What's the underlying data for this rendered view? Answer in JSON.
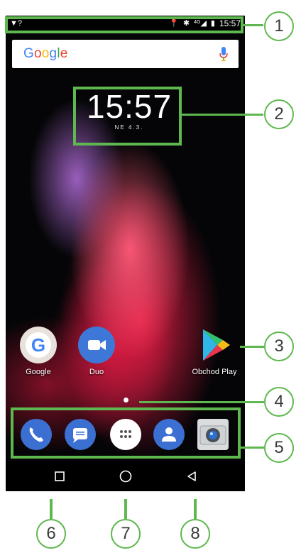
{
  "status_bar": {
    "time": "15:57",
    "network": "4G",
    "left_icon": "wifi-unknown-icon"
  },
  "search": {
    "logo_letters": [
      "G",
      "o",
      "o",
      "g",
      "l",
      "e"
    ],
    "mic_icon": "mic-icon"
  },
  "clock": {
    "time": "15:57",
    "date": "NE 4.3."
  },
  "apps": [
    {
      "label": "Google",
      "icon": "google-icon"
    },
    {
      "label": "Duo",
      "icon": "duo-icon"
    },
    {
      "label": "Obchod Play",
      "icon": "play-store-icon"
    }
  ],
  "dock": [
    "phone-icon",
    "messages-icon",
    "app-drawer-icon",
    "contacts-icon",
    "camera-icon"
  ],
  "nav": [
    "recents-button",
    "home-button",
    "back-button"
  ],
  "callouts": [
    "1",
    "2",
    "3",
    "4",
    "5",
    "6",
    "7",
    "8"
  ],
  "colors": {
    "annotation": "#5fb84f",
    "google_blue": "#4285F4",
    "dock_blue": "#3b6fd1"
  }
}
